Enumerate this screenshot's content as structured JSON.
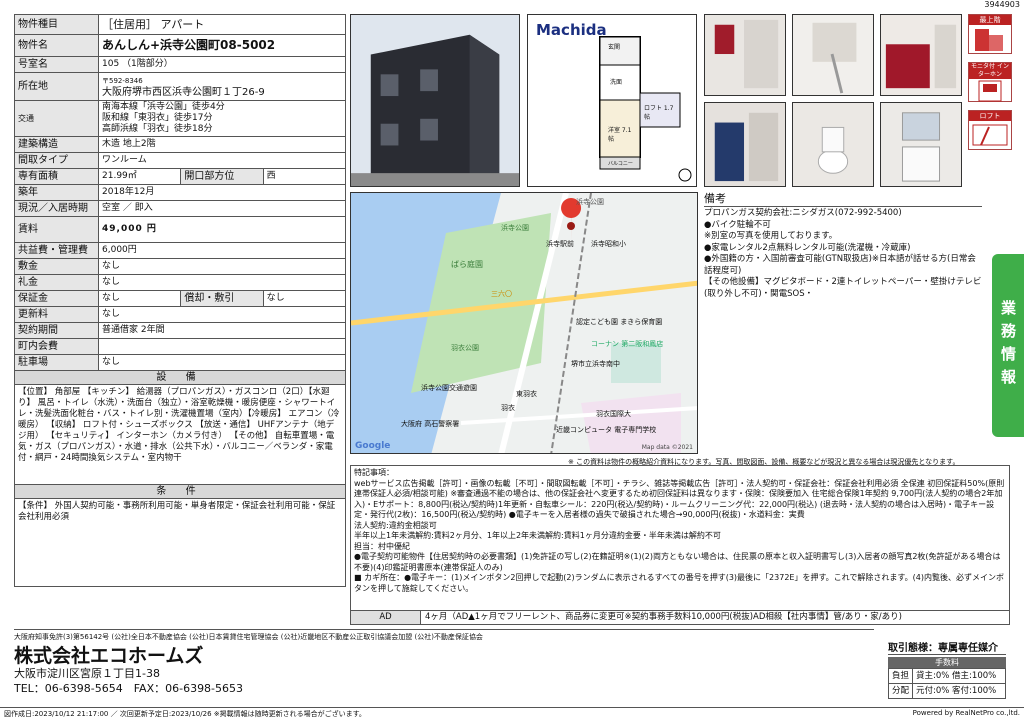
{
  "ref_id": "3944903",
  "rows": [
    {
      "label": "物件種目",
      "value": "［住居用］ アパート"
    },
    {
      "label": "物件名",
      "value": "あんしん+浜寺公園町08-5002"
    },
    {
      "label": "号室名",
      "value": "105 （1階部分）"
    }
  ],
  "address": {
    "label": "所在地",
    "zip": "〒592-8346",
    "value": "大阪府堺市西区浜寺公園町１丁26-9"
  },
  "transport": {
    "label": "交通",
    "lines": [
      "南海本線「浜寺公園」徒歩4分",
      "阪和線「東羽衣」徒歩17分",
      "高師浜線「羽衣」徒歩18分"
    ]
  },
  "structure": {
    "label": "建築構造",
    "value": "木造 地上2階"
  },
  "layout": {
    "label": "間取タイプ",
    "value": "ワンルーム"
  },
  "area": {
    "label": "専有面積",
    "value": "21.99㎡",
    "dir_label": "開口部方位",
    "dir_value": "西"
  },
  "built": {
    "label": "築年",
    "value": "2018年12月"
  },
  "status": {
    "label": "現況／入居時期",
    "value": "空室 ／ 即入"
  },
  "rent": {
    "label": "賃料",
    "value": "49,000 円"
  },
  "common": {
    "label": "共益費・管理費",
    "value": "6,000円"
  },
  "deposit_rows": [
    {
      "label": "敷金",
      "value": "なし"
    },
    {
      "label": "礼金",
      "value": "なし"
    }
  ],
  "guarantee": {
    "label": "保証金",
    "value": "なし",
    "sub_label": "償却・敷引",
    "sub_value": "なし"
  },
  "tail_rows": [
    {
      "label": "更新料",
      "value": "なし"
    },
    {
      "label": "契約期間",
      "value": "普通借家 2年間"
    },
    {
      "label": "町内会費",
      "value": ""
    },
    {
      "label": "駐車場",
      "value": "なし"
    }
  ],
  "facilities": {
    "title": "設 備",
    "text": "【位置】 角部屋 【キッチン】 給湯器（プロパンガス）・ガスコンロ（2口）【水廻り】 風呂・トイレ（水洗）・洗面台（独立）・浴室乾燥機・暖房便座・シャワートイレ・洗髪洗面化粧台・バス・トイレ別・洗濯機置場（室内）【冷暖房】 エアコン（冷暖房） 【収納】 ロフト付・シューズボックス 【放送・通信】 UHFアンテナ（地デジ用） 【セキュリティ】 インターホン（カメラ付き） 【その他】 自転車置場・電気・ガス（プロパンガス）・水道・排水（公共下水）・バルコニー／ベランダ・家電付・網戸・24時間換気システム・室内物干"
  },
  "conditions": {
    "title": "条 件",
    "text": "【条件】 外国人契約可能・事務所利用可能・単身者限定・保証会社利用可能・保証会社利用必須"
  },
  "floorplan": {
    "brand": "Machida",
    "rooms": [
      "玄関",
      "洗面",
      "ロフト 1.7帖",
      "洋室 7.1帖",
      "バルコニー"
    ]
  },
  "map": {
    "labels": [
      "浜寺公園",
      "浜寺駅前",
      "浜寺公園",
      "ばら庭園",
      "浜寺昭和小",
      "三六〇",
      "羽衣",
      "東羽衣",
      "大阪府 高石警察署",
      "近畿コンピュータ 電子専門学校",
      "羽衣国際大",
      "コーナン 第二阪和鳳店",
      "浜寺公園交通遊園",
      "堺市立浜寺南中",
      "認定こども園 まきら保育園",
      "羽衣公園"
    ],
    "credit": "Map data ©2021",
    "google": "Google"
  },
  "map_note": "※ この資料は物件の概略紹介資料になります。写真、間取図面、設備、概要などが現況と異なる場合は現況優先となります。",
  "remarks": {
    "title": "備考",
    "lines": [
      "プロパンガス契約会社:ニシダガス(072-992-5400)",
      "●バイク駐輪不可",
      "※別室の写真を使用しております。",
      "●家電レンタル2点無料レンタル可能(洗濯機・冷蔵庫)",
      "●外国籍の方・入国前審査可能(GTN取扱店)※日本語が話せる方(日常会話程度可)",
      "【その他設備】マグピタボード・2連トイレットペーパー・壁掛けテレビ(取り外し不可)・関電SOS・"
    ]
  },
  "side_icons": [
    "最上階",
    "モニタ付 インターホン",
    "ロフト"
  ],
  "side_tab": "業務情報",
  "notes": "特記事項：\nwebサービス広告掲載［許可］・画像の転載［不可］・間取図転載［不可］・チラシ、雑誌等掲載広告［許可］・法人契約可・保証会社：保証会社利用必須 全保連 初回保証料50%(原則連帯保証人必須/相談可能) ※審査通過不能の場合は、他の保証会社へ変更するため初回保証料は異なります・保険：保険要加入 住宅総合保険1年契約 9,700円(法人契約の場合2年加入)・Eサポート：8,800円(税込/契約時)1年更新・自転車シール：220円(税込/契約時)・ルームクリーニング代：22,000円(税込) (退去時・法人契約の場合は入居時)・電子キー設定・発行代(2枚)：16,500円(税込/契約時) ●電子キーを入居者様の過失で破損された場合→90,000円(税抜)・水道料金：実費\n法人契約:違約金相談可\n半年以上1年未満解約:賃料2ヶ月分、1年以上2年未満解約:賃料1ヶ月分違約金要・半年未満は解約不可\n担当：村中優紀\n●電子契約可能物件【住居契約時の必要書類】(1)免許証の写し(2)在籍証明※(1)(2)両方ともない場合は、住民票の原本と収入証明書写し(3)入居者の顔写真2枚(免許証がある場合は不要)(4)印鑑証明書原本(連帯保証人のみ)\n■ カギ所在：●電子キー：(1)メインボタン2回押しで起動(2)ランダムに表示されるすべての番号を押す(3)最後に「2372E」を押す。これで解除されます。(4)内覧後、必ずメインボタンを押して施錠してください。",
  "ad": {
    "label": "AD",
    "text": "4ヶ月（AD▲1ヶ月でフリーレント、商品券に変更可※契約事務手数料10,000円(税抜)AD相殺【社内事情】管/あり・家/あり)"
  },
  "footer": {
    "licenses": "大阪府知事免許(3)第56142号 (公社)全日本不動産協会 (公社)日本賃貸住宅管理協会 (公社)近畿地区不動産公正取引協議会加盟 (公社)不動産保証協会",
    "company": "株式会社エコホームズ",
    "company_addr": "大阪市淀川区宮原１丁目1-38",
    "tel": "TEL：06-6398-5654　FAX：06-6398-5653",
    "dates": "図作成日:2023/10/12 21:17:00 ／ 次回更新予定日:2023/10/26 ※掲載情報は随時更新される場合がございます。",
    "powered": "Powered by RealNetPro co.,ltd."
  },
  "fee": {
    "title": "取引態様：専属専任媒介",
    "sub": "手数料",
    "rows": [
      {
        "k": "負担",
        "v": "貸主:0% 借主:100%"
      },
      {
        "k": "分配",
        "v": "元付:0% 客付:100%"
      }
    ]
  }
}
